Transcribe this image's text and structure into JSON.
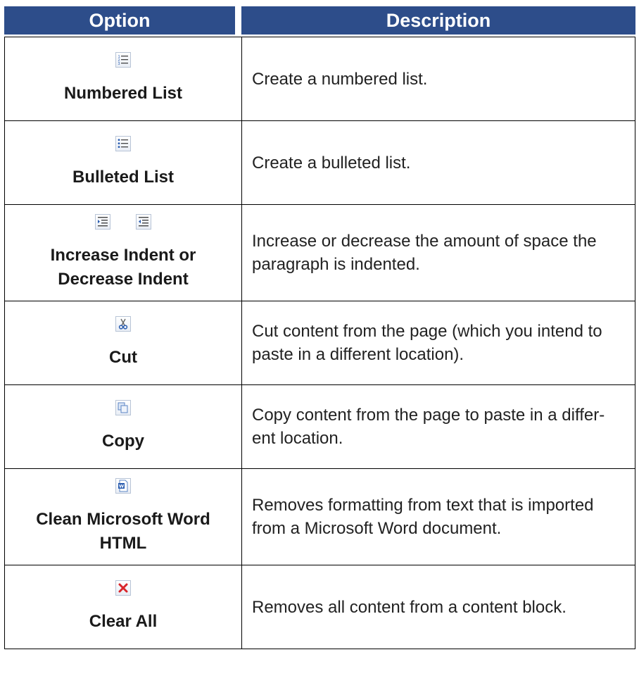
{
  "header": {
    "option": "Option",
    "description": "Description"
  },
  "rows": [
    {
      "icons": [
        "numbered-list-icon"
      ],
      "label": "Numbered List",
      "description": "Create a numbered list."
    },
    {
      "icons": [
        "bulleted-list-icon"
      ],
      "label": "Bulleted List",
      "description": "Create a bulleted list."
    },
    {
      "icons": [
        "increase-indent-icon",
        "decrease-indent-icon"
      ],
      "label_line1": "Increase Indent or",
      "label_line2": "Decrease Indent",
      "description": "Increase or decrease the amount of space the paragraph is indented."
    },
    {
      "icons": [
        "cut-icon"
      ],
      "label": "Cut",
      "description": "Cut content from the page (which you intend to paste in a different location)."
    },
    {
      "icons": [
        "copy-icon"
      ],
      "label": "Copy",
      "description_line1": "Copy content from the page to paste in a differ-",
      "description_line2": "ent location."
    },
    {
      "icons": [
        "clean-word-html-icon"
      ],
      "label_line1": "Clean Microsoft Word",
      "label_line2": "HTML",
      "description": "Removes formatting from text that is imported from a Microsoft Word document."
    },
    {
      "icons": [
        "clear-all-icon"
      ],
      "label": "Clear All",
      "description": "Removes all content from a content block."
    }
  ],
  "colors": {
    "header_bg": "#2d4d8a",
    "header_text": "#ffffff",
    "border": "#000000",
    "clear_icon_red": "#d9262b"
  }
}
